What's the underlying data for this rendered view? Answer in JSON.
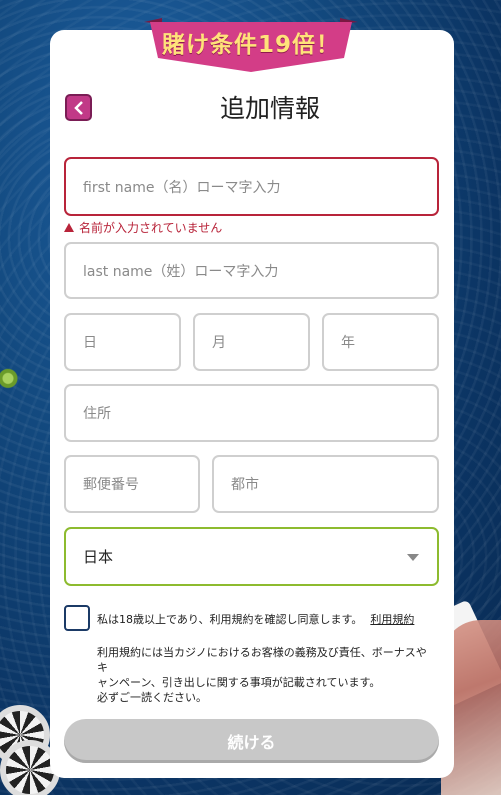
{
  "banner": {
    "text": "賭け条件19倍！"
  },
  "header": {
    "title": "追加情報",
    "back_icon": "chevron-left-icon"
  },
  "form": {
    "first_name": {
      "placeholder": "first name（名）ローマ字入力",
      "error": "名前が入力されていません"
    },
    "last_name": {
      "placeholder": "last name（姓）ローマ字入力"
    },
    "birth": {
      "day": "日",
      "month": "月",
      "year": "年"
    },
    "address": {
      "placeholder": "住所"
    },
    "postal_code": {
      "placeholder": "郵便番号"
    },
    "city": {
      "placeholder": "都市"
    },
    "country": {
      "value": "日本"
    },
    "consent": {
      "text": "私は18歳以上であり、利用規約を確認し同意します。",
      "link": "利用規約"
    },
    "note_lines": [
      "利用規約には当カジノにおけるお客様の義務及び責任、ボーナスやキ",
      "ャンペーン、引き出しに関する事項が記載されています。",
      "必ずご一読ください。"
    ],
    "submit": "続ける"
  },
  "colors": {
    "accent": "#c13987",
    "error": "#b8243a",
    "valid": "#8dbb2f",
    "button_disabled": "#c8c8c8"
  }
}
